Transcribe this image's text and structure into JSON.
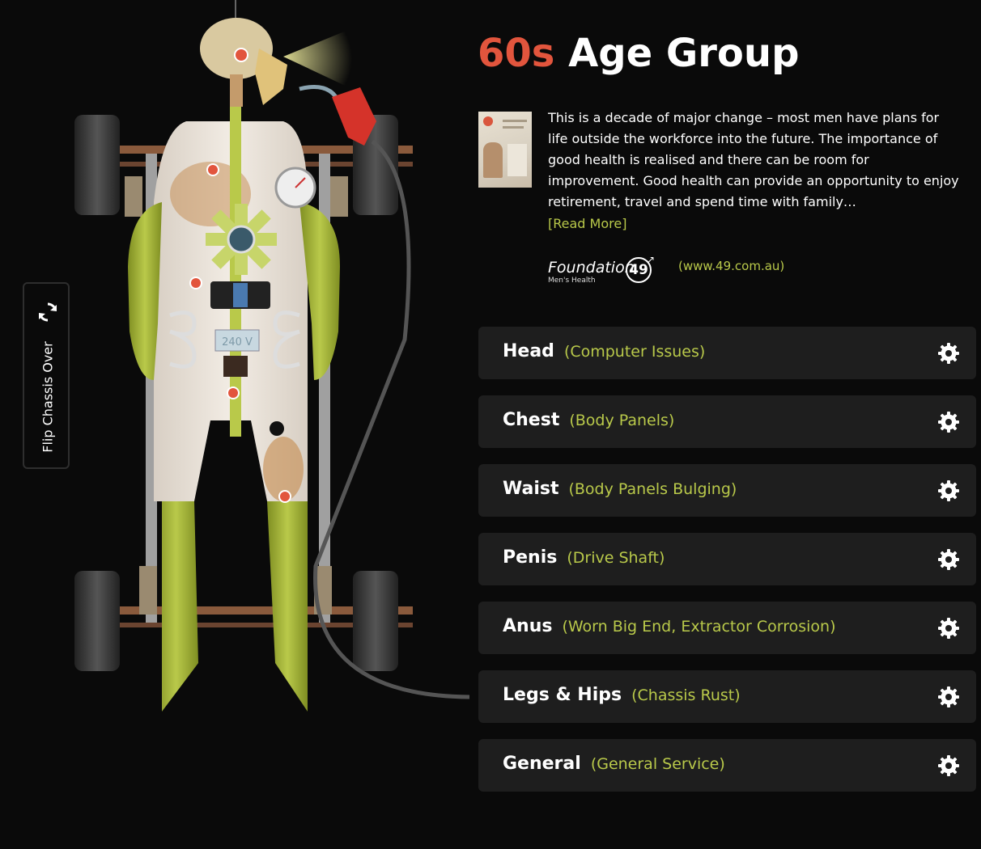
{
  "title": {
    "accent": "60s",
    "main": " Age Group"
  },
  "flip_chassis": {
    "label": "Flip Chassis Over",
    "icon": "refresh-icon"
  },
  "intro": {
    "text": "This is a decade of major change – most men have plans for life outside the workforce into the future. The importance of good health is realised and there can be room for improvement. Good health can provide an opportunity to enjoy retirement, travel and spend time with family…",
    "read_more": "[Read More]"
  },
  "foundation": {
    "logo_word": "Foundation",
    "logo_number": "49",
    "logo_sub": "Men's Health",
    "url": "(www.49.com.au)"
  },
  "figure": {
    "panel_label": "240 V"
  },
  "sections": [
    {
      "name": "Head",
      "sub": "(Computer Issues)"
    },
    {
      "name": "Chest",
      "sub": "(Body Panels)"
    },
    {
      "name": "Waist",
      "sub": "(Body Panels Bulging)"
    },
    {
      "name": "Penis",
      "sub": "(Drive Shaft)"
    },
    {
      "name": "Anus",
      "sub": "(Worn Big End, Extractor Corrosion)"
    },
    {
      "name": "Legs & Hips",
      "sub": "(Chassis Rust)"
    },
    {
      "name": "General",
      "sub": "(General Service)"
    }
  ],
  "colors": {
    "accent": "#e2553d",
    "secondary": "#b9c94a",
    "background": "#0a0a0a",
    "row": "#1e1e1e"
  }
}
